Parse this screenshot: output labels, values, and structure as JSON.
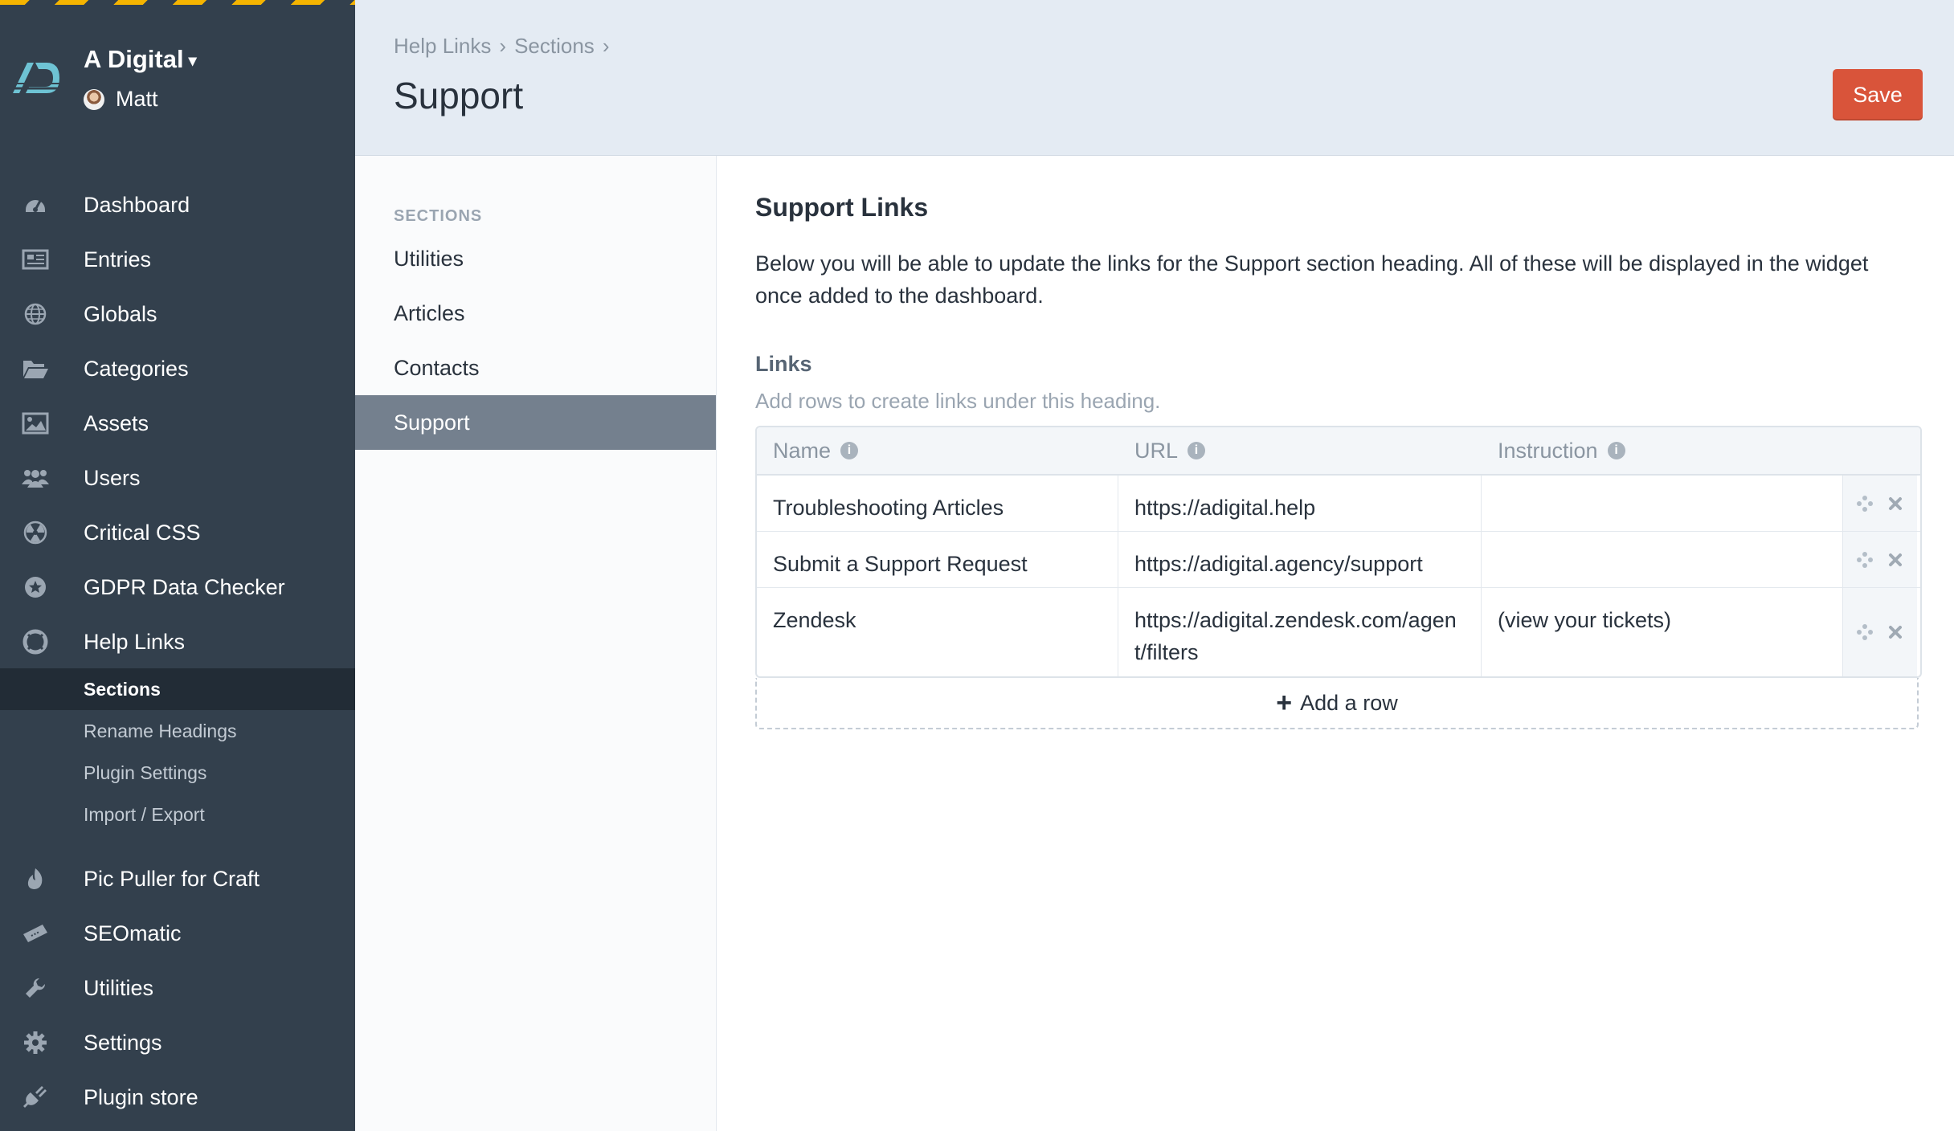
{
  "sidebar": {
    "site_name": "A Digital",
    "user_name": "Matt",
    "nav": [
      {
        "label": "Dashboard",
        "icon": "dashboard-icon"
      },
      {
        "label": "Entries",
        "icon": "entries-icon"
      },
      {
        "label": "Globals",
        "icon": "globe-icon"
      },
      {
        "label": "Categories",
        "icon": "folder-icon"
      },
      {
        "label": "Assets",
        "icon": "image-icon"
      },
      {
        "label": "Users",
        "icon": "users-icon"
      },
      {
        "label": "Critical CSS",
        "icon": "radioactive-icon"
      },
      {
        "label": "GDPR Data Checker",
        "icon": "badge-star-icon"
      },
      {
        "label": "Help Links",
        "icon": "lifebuoy-icon"
      }
    ],
    "help_links_sub": [
      {
        "label": "Sections"
      },
      {
        "label": "Rename Headings"
      },
      {
        "label": "Plugin Settings"
      },
      {
        "label": "Import / Export"
      }
    ],
    "nav_bottom": [
      {
        "label": "Pic Puller for Craft",
        "icon": "flame-icon"
      },
      {
        "label": "SEOmatic",
        "icon": "ticket-icon"
      },
      {
        "label": "Utilities",
        "icon": "wrench-icon"
      },
      {
        "label": "Settings",
        "icon": "gear-icon"
      },
      {
        "label": "Plugin store",
        "icon": "plug-icon"
      }
    ]
  },
  "header": {
    "breadcrumb": [
      "Help Links",
      "Sections"
    ],
    "title": "Support",
    "save_label": "Save"
  },
  "sections_pane": {
    "heading": "SECTIONS",
    "items": [
      "Utilities",
      "Articles",
      "Contacts",
      "Support"
    ],
    "active": "Support"
  },
  "content": {
    "heading": "Support Links",
    "description": "Below you will be able to update the links for the Support section heading. All of these will be displayed in the widget once added to the dashboard.",
    "links_label": "Links",
    "links_instructions": "Add rows to create links under this heading.",
    "table": {
      "columns": [
        "Name",
        "URL",
        "Instruction"
      ],
      "rows": [
        {
          "name": "Troubleshooting Articles",
          "url": "https://adigital.help",
          "instruction": ""
        },
        {
          "name": "Submit a Support Request",
          "url": "https://adigital.agency/support",
          "instruction": ""
        },
        {
          "name": "Zendesk",
          "url": "https://adigital.zendesk.com/agent/filters",
          "instruction": "(view your tickets)"
        }
      ]
    },
    "add_row_label": "Add a row"
  },
  "colors": {
    "sidebar_bg": "#33404d",
    "header_bg": "#e4ebf3",
    "save_button": "#d9543a",
    "active_section_bg": "#74808e",
    "active_subnav_bg": "#222c36"
  }
}
